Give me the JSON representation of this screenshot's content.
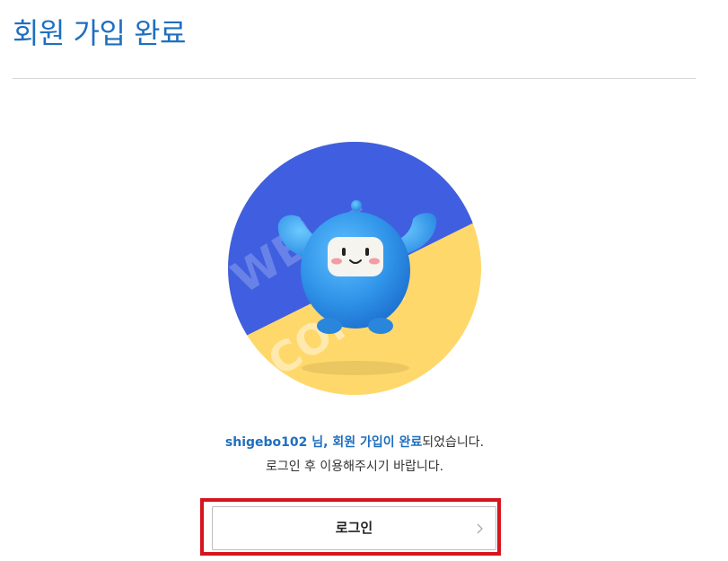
{
  "header": {
    "title": "회원 가입 완료"
  },
  "illustration": {
    "watermark_top": "WEL—",
    "watermark_bottom": "COME!",
    "colors": {
      "top": "#3f5fe0",
      "bottom": "#ffd86b",
      "mascot": "#2f93e8"
    }
  },
  "message": {
    "username": "shigebo102",
    "highlight_suffix": " 님, 회원 가입이 완료",
    "line1_tail": "되었습니다.",
    "line2": "로그인 후 이용해주시기 바랍니다."
  },
  "login_button": {
    "label": "로그인",
    "icon": "chevron-right-icon"
  },
  "colors": {
    "accent": "#1f6fbf",
    "highlight_frame": "#d6141e"
  }
}
